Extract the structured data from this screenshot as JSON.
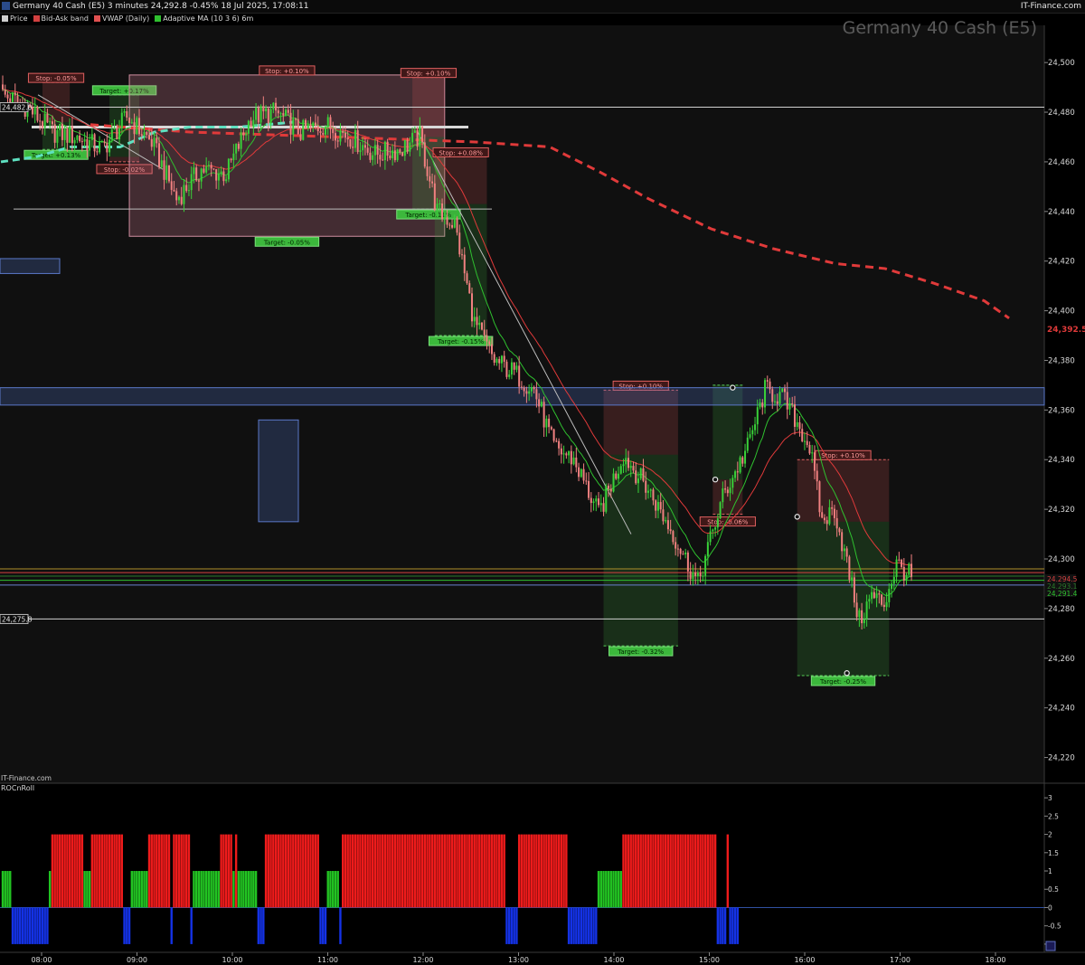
{
  "header": {
    "title": "Germany 40 Cash (E5) 3 minutes 24,292.8 -0.45% 18 Jul 2025, 17:08:11",
    "brand": "IT-Finance.com"
  },
  "legend": [
    {
      "label": "Price",
      "color": "#d0d0d0"
    },
    {
      "label": "Bid-Ask band",
      "color": "#d24040"
    },
    {
      "label": "VWAP (Daily)",
      "color": "#e05050"
    },
    {
      "label": "Adaptive MA (10 3 6) 6m",
      "color": "#2fc02f"
    }
  ],
  "watermark": "Germany 40 Cash (E5)",
  "footer_brand": "IT-Finance.com",
  "subpanel_title": "ROCnRoll",
  "colors": {
    "up": "#39d139",
    "down": "#f08080",
    "vwap": "#e03a3a",
    "ama": "#2fc02f",
    "bg": "#000000"
  },
  "chart_data": [
    {
      "type": "candlestick",
      "ylim": [
        24210,
        24515
      ],
      "y_ticks": [
        24220,
        24240,
        24260,
        24280,
        24300,
        24320,
        24340,
        24360,
        24380,
        24400,
        24420,
        24440,
        24460,
        24480,
        24500
      ],
      "x_ticks": [
        "08:00",
        "09:00",
        "10:00",
        "11:00",
        "12:00",
        "13:00",
        "14:00",
        "15:00",
        "16:00",
        "17:00",
        "18:00"
      ],
      "price_labels": [
        {
          "text": "24,392.5",
          "value": 24392.5,
          "color": "#e03a3a"
        },
        {
          "text": "24,294.5",
          "value": 24294.5,
          "color": "#d24040"
        },
        {
          "text": "24,293.1",
          "value": 24293.1,
          "color": "#2a7a2a"
        },
        {
          "text": "24,291.4",
          "value": 24291.4,
          "color": "#2fc02f"
        }
      ],
      "left_labels": [
        {
          "text": "24,482.0",
          "value": 24482.0
        },
        {
          "text": "24,275.8",
          "value": 24275.8
        }
      ],
      "series": [
        {
          "name": "Price",
          "anchors": [
            [
              0,
              24487
            ],
            [
              10,
              24482
            ],
            [
              20,
              24472
            ],
            [
              30,
              24470
            ],
            [
              40,
              24465
            ],
            [
              50,
              24478
            ],
            [
              60,
              24468
            ],
            [
              70,
              24445
            ],
            [
              80,
              24457
            ],
            [
              90,
              24455
            ],
            [
              100,
              24478
            ],
            [
              110,
              24480
            ],
            [
              120,
              24472
            ],
            [
              130,
              24475
            ],
            [
              140,
              24470
            ],
            [
              150,
              24463
            ],
            [
              160,
              24465
            ],
            [
              168,
              24470
            ],
            [
              175,
              24440
            ],
            [
              182,
              24435
            ],
            [
              190,
              24395
            ],
            [
              198,
              24380
            ],
            [
              206,
              24375
            ],
            [
              214,
              24368
            ],
            [
              222,
              24345
            ],
            [
              230,
              24340
            ],
            [
              240,
              24318
            ],
            [
              250,
              24342
            ],
            [
              260,
              24328
            ],
            [
              270,
              24310
            ],
            [
              280,
              24290
            ],
            [
              290,
              24325
            ],
            [
              300,
              24345
            ],
            [
              307,
              24368
            ],
            [
              314,
              24365
            ],
            [
              320,
              24355
            ],
            [
              325,
              24345
            ],
            [
              330,
              24315
            ],
            [
              335,
              24320
            ],
            [
              340,
              24298
            ],
            [
              345,
              24275
            ],
            [
              350,
              24285
            ],
            [
              355,
              24282
            ],
            [
              360,
              24298
            ],
            [
              366,
              24292.8
            ]
          ],
          "total_bars": 367
        }
      ],
      "trade_boxes": [
        {
          "stop_label": "Stop: -0.05%",
          "target_label": "Target: +0.13%"
        },
        {
          "stop_label": "Stop: -0.02%",
          "target_label": "Target: +0.17%"
        },
        {
          "stop_label": "Stop: +0.10%",
          "target_label": "Target: -0.05%"
        },
        {
          "stop_label": "Stop: +0.10%",
          "target_label": "Target: -0.11%"
        },
        {
          "stop_label": "Stop: +0.08%",
          "target_label": "Target: -0.15%"
        },
        {
          "stop_label": "Stop: +0.10%",
          "target_label": "Target: -0.32%"
        },
        {
          "stop_label": "Stop: -0.06%",
          "target_label": ""
        },
        {
          "stop_label": "Stop: +0.10%",
          "target_label": "Target: -0.25%"
        }
      ],
      "horizontal_levels": [
        24482.0,
        24441,
        24442,
        24482,
        24275.8,
        24294.5,
        24293.1,
        24291.4,
        24289.5
      ]
    },
    {
      "type": "bar",
      "title": "ROCnRoll",
      "ylim": [
        -1.2,
        3.3
      ],
      "y_ticks": [
        -1,
        -0.5,
        0,
        0.5,
        1,
        1.5,
        2,
        2.5,
        3
      ],
      "y_tick_labels": [
        "-1",
        "-0.5",
        "0",
        "0.5",
        "1",
        "1.5",
        "2",
        "2.5",
        "3"
      ],
      "segments": [
        {
          "state": "green",
          "value": 1,
          "bars": 4
        },
        {
          "state": "blue",
          "value": -1,
          "bars": 15
        },
        {
          "state": "green",
          "value": 1,
          "bars": 1
        },
        {
          "state": "red",
          "value": 2,
          "bars": 13
        },
        {
          "state": "green",
          "value": 1,
          "bars": 3
        },
        {
          "state": "red",
          "value": 2,
          "bars": 13
        },
        {
          "state": "blue",
          "value": -1,
          "bars": 3
        },
        {
          "state": "green",
          "value": 1,
          "bars": 7
        },
        {
          "state": "red",
          "value": 2,
          "bars": 9
        },
        {
          "state": "blue",
          "value": -1,
          "bars": 1
        },
        {
          "state": "red",
          "value": 2,
          "bars": 7
        },
        {
          "state": "blue",
          "value": -1,
          "bars": 1
        },
        {
          "state": "green",
          "value": 1,
          "bars": 11
        },
        {
          "state": "red",
          "value": 2,
          "bars": 5
        },
        {
          "state": "green",
          "value": 1,
          "bars": 1
        },
        {
          "state": "red",
          "value": 2,
          "bars": 1
        },
        {
          "state": "green",
          "value": 1,
          "bars": 8
        },
        {
          "state": "blue",
          "value": -1,
          "bars": 3
        },
        {
          "state": "red",
          "value": 2,
          "bars": 22
        },
        {
          "state": "blue",
          "value": -1,
          "bars": 3
        },
        {
          "state": "green",
          "value": 1,
          "bars": 5
        },
        {
          "state": "blue",
          "value": -1,
          "bars": 1
        },
        {
          "state": "red",
          "value": 2,
          "bars": 10
        },
        {
          "state": "red",
          "value": 2,
          "bars": 56
        },
        {
          "state": "blue",
          "value": -1,
          "bars": 5
        },
        {
          "state": "red",
          "value": 2,
          "bars": 20
        },
        {
          "state": "blue",
          "value": -1,
          "bars": 12
        },
        {
          "state": "green",
          "value": 1,
          "bars": 10
        },
        {
          "state": "red",
          "value": 2,
          "bars": 38
        },
        {
          "state": "blue",
          "value": -1,
          "bars": 4
        },
        {
          "state": "red",
          "value": 2,
          "bars": 1
        },
        {
          "state": "blue",
          "value": -1,
          "bars": 4
        }
      ]
    }
  ]
}
